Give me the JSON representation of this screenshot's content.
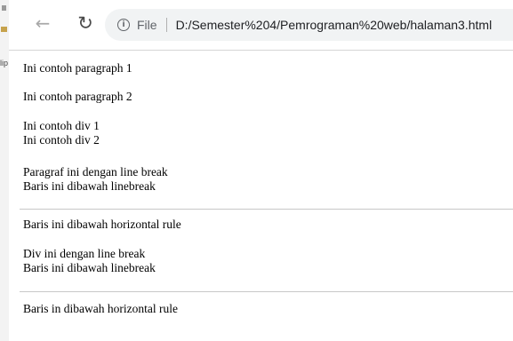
{
  "desktop_strip": {
    "text": "lip"
  },
  "address_bar": {
    "security_label": "File",
    "url": "D:/Semester%204/Pemrograman%20web/halaman3.html"
  },
  "page": {
    "para1": "Ini contoh paragraph 1",
    "para2": "Ini contoh paragraph 2",
    "div1": "Ini contoh div 1",
    "div2": "Ini contoh div 2",
    "para_lb_line1": "Paragraf ini dengan line break",
    "para_lb_line2": "Baris ini dibawah linebreak",
    "after_hr1": "Baris ini dibawah horizontal rule",
    "div_lb_line1": "Div ini dengan line break",
    "div_lb_line2": "Baris ini dibawah linebreak",
    "after_hr2": "Baris in dibawah horizontal rule"
  }
}
